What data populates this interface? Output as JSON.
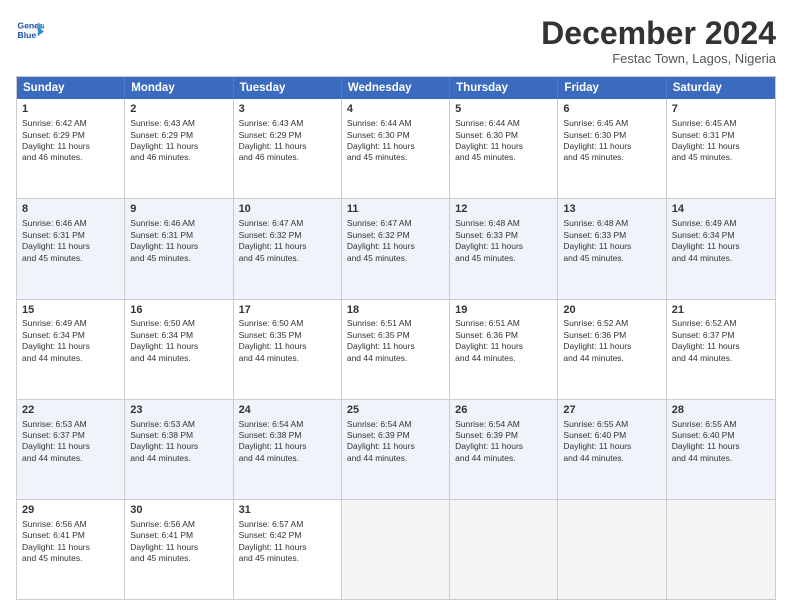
{
  "logo": {
    "line1": "General",
    "line2": "Blue"
  },
  "title": "December 2024",
  "subtitle": "Festac Town, Lagos, Nigeria",
  "header_days": [
    "Sunday",
    "Monday",
    "Tuesday",
    "Wednesday",
    "Thursday",
    "Friday",
    "Saturday"
  ],
  "weeks": [
    [
      {
        "day": "1",
        "rise": "6:42 AM",
        "set": "6:29 PM",
        "hours": "11 hours",
        "mins": "46"
      },
      {
        "day": "2",
        "rise": "6:43 AM",
        "set": "6:29 PM",
        "hours": "11 hours",
        "mins": "46"
      },
      {
        "day": "3",
        "rise": "6:43 AM",
        "set": "6:29 PM",
        "hours": "11 hours",
        "mins": "46"
      },
      {
        "day": "4",
        "rise": "6:44 AM",
        "set": "6:30 PM",
        "hours": "11 hours",
        "mins": "45"
      },
      {
        "day": "5",
        "rise": "6:44 AM",
        "set": "6:30 PM",
        "hours": "11 hours",
        "mins": "45"
      },
      {
        "day": "6",
        "rise": "6:45 AM",
        "set": "6:30 PM",
        "hours": "11 hours",
        "mins": "45"
      },
      {
        "day": "7",
        "rise": "6:45 AM",
        "set": "6:31 PM",
        "hours": "11 hours",
        "mins": "45"
      }
    ],
    [
      {
        "day": "8",
        "rise": "6:46 AM",
        "set": "6:31 PM",
        "hours": "11 hours",
        "mins": "45"
      },
      {
        "day": "9",
        "rise": "6:46 AM",
        "set": "6:31 PM",
        "hours": "11 hours",
        "mins": "45"
      },
      {
        "day": "10",
        "rise": "6:47 AM",
        "set": "6:32 PM",
        "hours": "11 hours",
        "mins": "45"
      },
      {
        "day": "11",
        "rise": "6:47 AM",
        "set": "6:32 PM",
        "hours": "11 hours",
        "mins": "45"
      },
      {
        "day": "12",
        "rise": "6:48 AM",
        "set": "6:33 PM",
        "hours": "11 hours",
        "mins": "45"
      },
      {
        "day": "13",
        "rise": "6:48 AM",
        "set": "6:33 PM",
        "hours": "11 hours",
        "mins": "45"
      },
      {
        "day": "14",
        "rise": "6:49 AM",
        "set": "6:34 PM",
        "hours": "11 hours",
        "mins": "44"
      }
    ],
    [
      {
        "day": "15",
        "rise": "6:49 AM",
        "set": "6:34 PM",
        "hours": "11 hours",
        "mins": "44"
      },
      {
        "day": "16",
        "rise": "6:50 AM",
        "set": "6:34 PM",
        "hours": "11 hours",
        "mins": "44"
      },
      {
        "day": "17",
        "rise": "6:50 AM",
        "set": "6:35 PM",
        "hours": "11 hours",
        "mins": "44"
      },
      {
        "day": "18",
        "rise": "6:51 AM",
        "set": "6:35 PM",
        "hours": "11 hours",
        "mins": "44"
      },
      {
        "day": "19",
        "rise": "6:51 AM",
        "set": "6:36 PM",
        "hours": "11 hours",
        "mins": "44"
      },
      {
        "day": "20",
        "rise": "6:52 AM",
        "set": "6:36 PM",
        "hours": "11 hours",
        "mins": "44"
      },
      {
        "day": "21",
        "rise": "6:52 AM",
        "set": "6:37 PM",
        "hours": "11 hours",
        "mins": "44"
      }
    ],
    [
      {
        "day": "22",
        "rise": "6:53 AM",
        "set": "6:37 PM",
        "hours": "11 hours",
        "mins": "44"
      },
      {
        "day": "23",
        "rise": "6:53 AM",
        "set": "6:38 PM",
        "hours": "11 hours",
        "mins": "44"
      },
      {
        "day": "24",
        "rise": "6:54 AM",
        "set": "6:38 PM",
        "hours": "11 hours",
        "mins": "44"
      },
      {
        "day": "25",
        "rise": "6:54 AM",
        "set": "6:39 PM",
        "hours": "11 hours",
        "mins": "44"
      },
      {
        "day": "26",
        "rise": "6:54 AM",
        "set": "6:39 PM",
        "hours": "11 hours",
        "mins": "44"
      },
      {
        "day": "27",
        "rise": "6:55 AM",
        "set": "6:40 PM",
        "hours": "11 hours",
        "mins": "44"
      },
      {
        "day": "28",
        "rise": "6:55 AM",
        "set": "6:40 PM",
        "hours": "11 hours",
        "mins": "44"
      }
    ],
    [
      {
        "day": "29",
        "rise": "6:56 AM",
        "set": "6:41 PM",
        "hours": "11 hours",
        "mins": "45"
      },
      {
        "day": "30",
        "rise": "6:56 AM",
        "set": "6:41 PM",
        "hours": "11 hours",
        "mins": "45"
      },
      {
        "day": "31",
        "rise": "6:57 AM",
        "set": "6:42 PM",
        "hours": "11 hours",
        "mins": "45"
      },
      null,
      null,
      null,
      null
    ]
  ]
}
